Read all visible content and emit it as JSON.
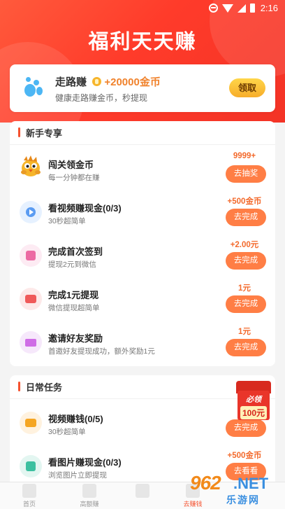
{
  "status_bar": {
    "time": "2:16"
  },
  "header": {
    "title": "福利天天赚"
  },
  "walk_card": {
    "title": "走路赚",
    "reward": "+20000金币",
    "subtitle": "健康走路赚金币，秒提现",
    "button": "领取"
  },
  "newbie": {
    "title": "新手专享",
    "tasks": [
      {
        "title": "闯关领金币",
        "subtitle": "每一分钟都在赚",
        "reward": "9999+",
        "button": "去抽奖",
        "icon": "chick-icon"
      },
      {
        "title": "看视频赚现金(0/3)",
        "subtitle": "30秒超简单",
        "reward": "+500金币",
        "button": "去完成",
        "icon": "play-icon"
      },
      {
        "title": "完成首次签到",
        "subtitle": "提现2元到微信",
        "reward": "+2.00元",
        "button": "去完成",
        "icon": "calendar-icon"
      },
      {
        "title": "完成1元提现",
        "subtitle": "微信提现超简单",
        "reward": "1元",
        "button": "去完成",
        "icon": "withdraw-icon"
      },
      {
        "title": "邀请好友奖励",
        "subtitle": "首邀好友提现成功，额外奖励1元",
        "reward": "1元",
        "button": "去完成",
        "icon": "envelope-icon"
      }
    ]
  },
  "daily": {
    "title": "日常任务",
    "tasks": [
      {
        "title": "视频赚钱(0/5)",
        "subtitle": "30秒超简单",
        "reward": "+5",
        "button": "去完成",
        "icon": "video-icon"
      },
      {
        "title": "看图片赚现金(0/3)",
        "subtitle": "浏览图片立即提现",
        "reward": "+500金币",
        "button": "去看看",
        "icon": "image-icon"
      }
    ]
  },
  "float_badge": {
    "line1": "必领",
    "line2": "100元"
  },
  "tabbar": {
    "items": [
      {
        "label": "首页"
      },
      {
        "label": "高额赚"
      },
      {
        "label": ""
      },
      {
        "label": "去赚钱"
      }
    ]
  },
  "watermark": {
    "number": "962",
    "suffix": ".NET",
    "sub": "乐游网"
  },
  "colors": {
    "accent": "#f5512e",
    "button": "#ff7e45",
    "reward": "#f36a2c",
    "header": "#ff4a30"
  }
}
